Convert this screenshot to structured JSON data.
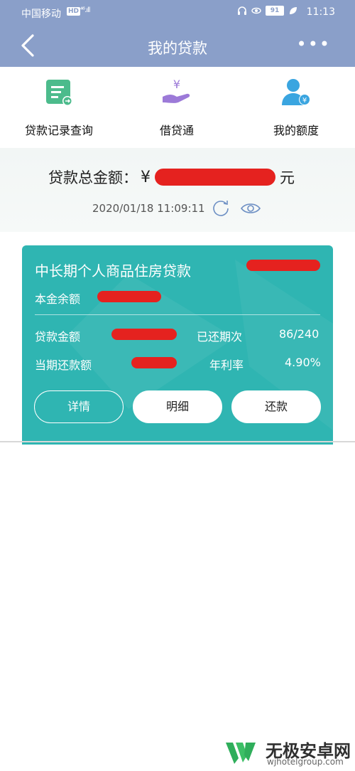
{
  "status_bar": {
    "carrier": "中国移动",
    "network_badge": "HD",
    "signal": "⁴⁶.ıll",
    "battery": "91",
    "time": "11:13"
  },
  "header": {
    "title": "我的贷款",
    "more": "•••",
    "back_icon": "chevron-left-icon"
  },
  "quick_entries": [
    {
      "label": "贷款记录查询",
      "icon": "record-search-icon",
      "color": "#4cbb8c"
    },
    {
      "label": "借贷通",
      "icon": "hand-yen-icon",
      "color": "#9c7ad8"
    },
    {
      "label": "我的额度",
      "icon": "user-yen-icon",
      "color": "#3aa5e0"
    }
  ],
  "summary": {
    "total_label": "贷款总金额：",
    "currency": "¥",
    "unit": "元",
    "datetime": "2020/01/18 11:09:11"
  },
  "loan_card": {
    "title": "中长期个人商品住房贷款",
    "principal_label": "本金余额",
    "loan_amount_label": "贷款金额",
    "repaid_periods_label": "已还期次",
    "repaid_periods_value": "86/240",
    "current_repayment_label": "当期还款额",
    "annual_rate_label": "年利率",
    "annual_rate_value": "4.90%",
    "buttons": {
      "details": "详情",
      "breakdown": "明细",
      "repay": "还款"
    },
    "color": "#2fb5b2"
  },
  "watermark": {
    "name": "无极安卓网",
    "url": "wjhotelgroup.com"
  }
}
